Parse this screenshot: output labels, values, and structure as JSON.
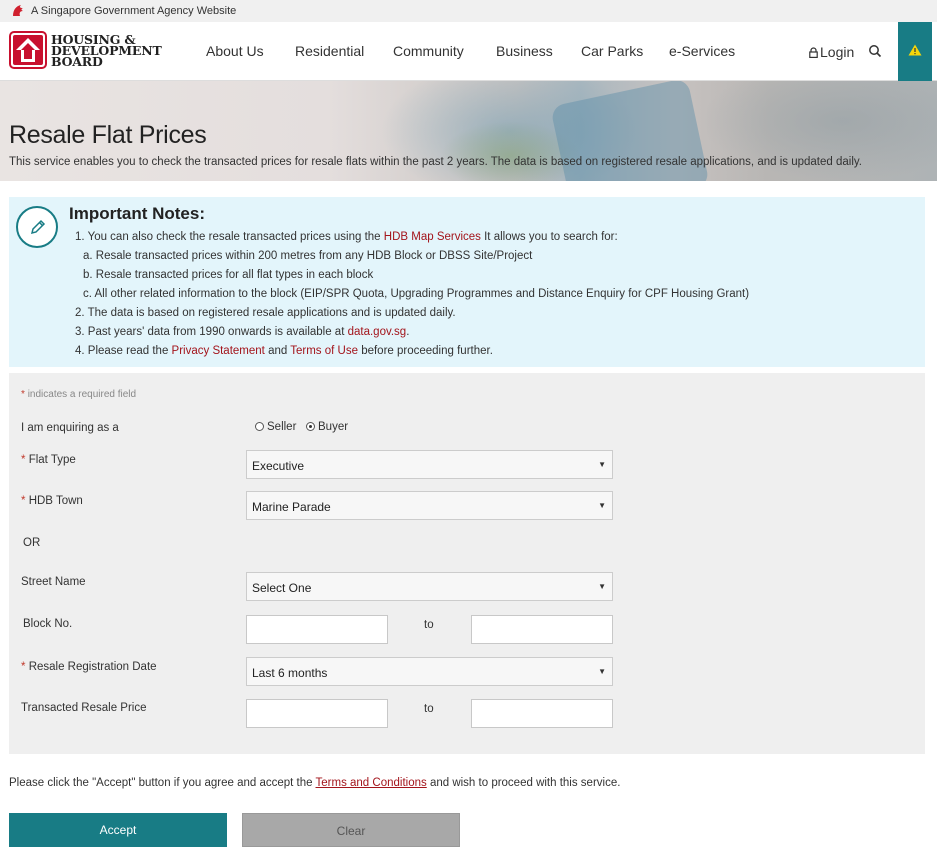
{
  "gov_bar": {
    "text": "A Singapore Government Agency Website",
    "icon": "lion-head-icon"
  },
  "header": {
    "logo_line1": "HOUSING &",
    "logo_line2": "DEVELOPMENT",
    "logo_line3": "BOARD",
    "nav": [
      "About Us",
      "Residential",
      "Community",
      "Business",
      "Car Parks",
      "e-Services"
    ],
    "login": "Login",
    "accent_color": "#187c85"
  },
  "hero": {
    "title": "Resale Flat Prices",
    "description": "This service enables you to check the transacted prices for resale flats within the past 2 years. The data is based on registered resale applications, and is updated daily."
  },
  "notes": {
    "title": "Important Notes:",
    "item1_pre": "1. You can also check the resale transacted prices using the ",
    "item1_link": "HDB Map Services",
    "item1_post": " It allows you to search for:",
    "item1a": "a. Resale transacted prices within 200 metres from any HDB Block or DBSS Site/Project",
    "item1b": "b. Resale transacted prices for all flat types in each block",
    "item1c": "c. All other related information to the block (EIP/SPR Quota, Upgrading Programmes and Distance Enquiry for CPF Housing Grant)",
    "item2": "2. The data is based on registered resale applications and is updated daily.",
    "item3_pre": "3. Past years' data from 1990 onwards is available at ",
    "item3_link": "data.gov.sg",
    "item3_post": ".",
    "item4_pre": "4. Please read the ",
    "item4_link1": "Privacy Statement",
    "item4_mid": " and ",
    "item4_link2": "Terms of Use",
    "item4_post": " before proceeding further."
  },
  "form": {
    "required_note": "indicates a required field",
    "enquiring_label": "I am enquiring as a",
    "seller_label": "Seller",
    "buyer_label": "Buyer",
    "selected_role": "Buyer",
    "flat_type_label": "Flat Type",
    "flat_type_value": "Executive",
    "hdb_town_label": "HDB Town",
    "hdb_town_value": "Marine Parade",
    "or_label": "OR",
    "street_label": "Street Name",
    "street_value": "Select One",
    "block_label": "Block No.",
    "to_label": "to",
    "reg_date_label": "Resale Registration Date",
    "reg_date_value": "Last 6 months",
    "price_label": "Transacted Resale Price"
  },
  "footer": {
    "text_pre": "Please click the \"Accept\" button if you agree and accept the ",
    "link": "Terms and Conditions",
    "text_post": " and wish to proceed with this service.",
    "accept": "Accept",
    "clear": "Clear"
  }
}
